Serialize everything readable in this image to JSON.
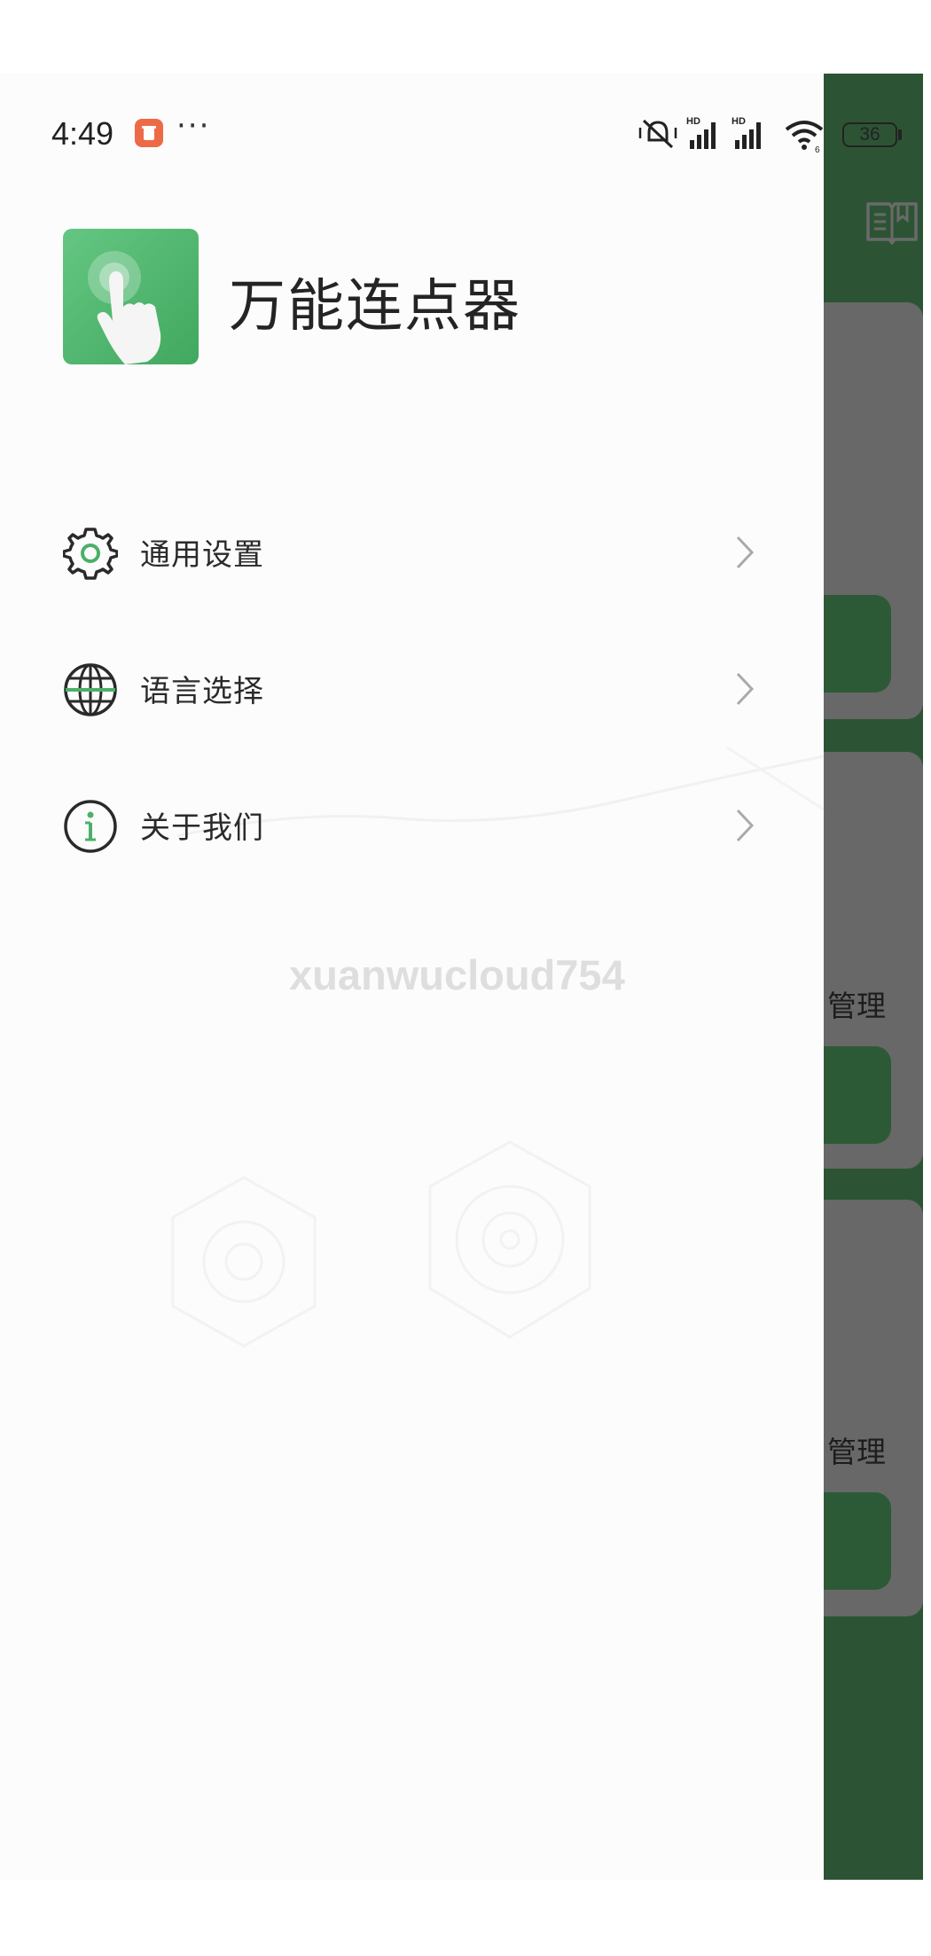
{
  "status_bar": {
    "time": "4:49",
    "dots": "···",
    "battery": "36",
    "icons": [
      "notification-icon",
      "mute-icon",
      "hd-signal-icon",
      "hd-signal-icon",
      "wifi-icon",
      "battery-icon"
    ]
  },
  "drawer": {
    "app_name": "万能连点器",
    "app_logo_icon": "tap-finger-icon",
    "menu": [
      {
        "label": "通用设置",
        "icon": "gear-icon"
      },
      {
        "label": "语言选择",
        "icon": "globe-icon"
      },
      {
        "label": "关于我们",
        "icon": "info-icon"
      }
    ]
  },
  "background_app": {
    "header_icon": "book-icon",
    "cards": [
      {
        "label": ""
      },
      {
        "label": "管理"
      },
      {
        "label": "管理"
      }
    ]
  },
  "watermark": "xuanwucloud754",
  "colors": {
    "accent_green": "#4caf6a",
    "background_green": "#2c5434",
    "notification_orange": "#ee6a47"
  }
}
